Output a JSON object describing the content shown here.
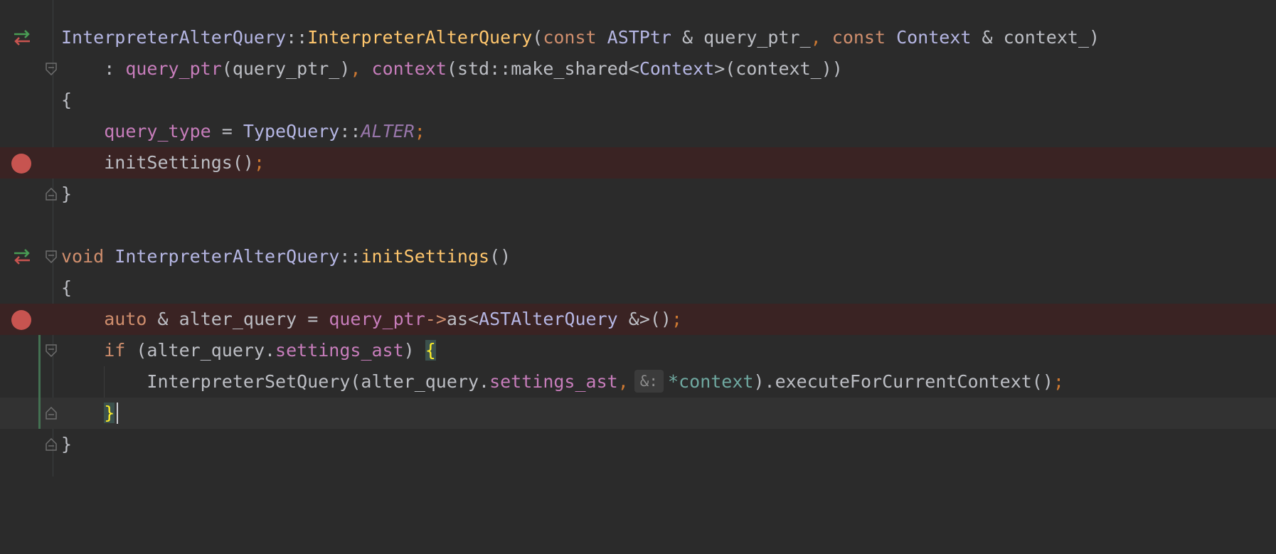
{
  "editor": {
    "lines": [
      {
        "id": "l1",
        "tokens": [
          {
            "t": "InterpreterAlterQuery",
            "c": "tok-type"
          },
          {
            "t": "::",
            "c": "tok-ns"
          },
          {
            "t": "InterpreterAlterQuery",
            "c": "tok-decl"
          },
          {
            "t": "(",
            "c": "tok-punc"
          },
          {
            "t": "const",
            "c": "tok-kw"
          },
          {
            "t": " ASTPtr ",
            "c": "tok-type"
          },
          {
            "t": "& query_ptr_",
            "c": "tok-cls"
          },
          {
            "t": ",",
            "c": "tok-comma"
          },
          {
            "t": " ",
            "c": "tok-cls"
          },
          {
            "t": "const",
            "c": "tok-kw"
          },
          {
            "t": " Context ",
            "c": "tok-type"
          },
          {
            "t": "& context_)",
            "c": "tok-cls"
          }
        ]
      },
      {
        "id": "l2",
        "tokens": [
          {
            "t": "    : ",
            "c": "tok-cls"
          },
          {
            "t": "query_ptr",
            "c": "tok-mem"
          },
          {
            "t": "(query_ptr_)",
            "c": "tok-cls"
          },
          {
            "t": ",",
            "c": "tok-comma"
          },
          {
            "t": " ",
            "c": "tok-cls"
          },
          {
            "t": "context",
            "c": "tok-mem"
          },
          {
            "t": "(std::make_shared<",
            "c": "tok-cls"
          },
          {
            "t": "Context",
            "c": "tok-type"
          },
          {
            "t": ">(context_))",
            "c": "tok-cls"
          }
        ]
      },
      {
        "id": "l3",
        "tokens": [
          {
            "t": "{",
            "c": "tok-punc"
          }
        ]
      },
      {
        "id": "l4",
        "tokens": [
          {
            "t": "    ",
            "c": "tok-cls"
          },
          {
            "t": "query_type",
            "c": "tok-mem"
          },
          {
            "t": " = ",
            "c": "tok-cls"
          },
          {
            "t": "TypeQuery",
            "c": "tok-type"
          },
          {
            "t": "::",
            "c": "tok-ns"
          },
          {
            "t": "ALTER",
            "c": "tok-const"
          },
          {
            "t": ";",
            "c": "tok-semi"
          }
        ]
      },
      {
        "id": "l5",
        "tokens": [
          {
            "t": "    initSettings()",
            "c": "tok-cls"
          },
          {
            "t": ";",
            "c": "tok-semi"
          }
        ]
      },
      {
        "id": "l6",
        "tokens": [
          {
            "t": "}",
            "c": "tok-punc"
          }
        ]
      },
      {
        "id": "l7",
        "tokens": []
      },
      {
        "id": "l8",
        "tokens": [
          {
            "t": "void",
            "c": "tok-kw"
          },
          {
            "t": " ",
            "c": "tok-cls"
          },
          {
            "t": "InterpreterAlterQuery",
            "c": "tok-type"
          },
          {
            "t": "::",
            "c": "tok-ns"
          },
          {
            "t": "initSettings",
            "c": "tok-decl"
          },
          {
            "t": "()",
            "c": "tok-punc"
          }
        ]
      },
      {
        "id": "l9",
        "tokens": [
          {
            "t": "{",
            "c": "tok-punc"
          }
        ]
      },
      {
        "id": "l10",
        "tokens": [
          {
            "t": "    ",
            "c": "tok-cls"
          },
          {
            "t": "auto",
            "c": "tok-kw"
          },
          {
            "t": " & alter_query = ",
            "c": "tok-cls"
          },
          {
            "t": "query_ptr",
            "c": "tok-mem"
          },
          {
            "t": "->",
            "c": "tok-kw"
          },
          {
            "t": "as<",
            "c": "tok-cls"
          },
          {
            "t": "ASTAlterQuery",
            "c": "tok-type"
          },
          {
            "t": " &>()",
            "c": "tok-cls"
          },
          {
            "t": ";",
            "c": "tok-semi"
          }
        ]
      },
      {
        "id": "l11",
        "tokens": [
          {
            "t": "    ",
            "c": "tok-cls"
          },
          {
            "t": "if",
            "c": "tok-kw"
          },
          {
            "t": " (alter_query.",
            "c": "tok-cls"
          },
          {
            "t": "settings_ast",
            "c": "tok-mem"
          },
          {
            "t": ") ",
            "c": "tok-cls"
          },
          {
            "t": "{",
            "c": "tok-brace-hl"
          }
        ]
      },
      {
        "id": "l12",
        "tokens": [
          {
            "t": "        InterpreterSetQuery(alter_query.",
            "c": "tok-cls"
          },
          {
            "t": "settings_ast",
            "c": "tok-mem"
          },
          {
            "t": ",",
            "c": "tok-comma"
          },
          {
            "t": "&:",
            "c": "tok-hint"
          },
          {
            "t": "*context",
            "c": "tok-ctx"
          },
          {
            "t": ").executeForCurrentContext()",
            "c": "tok-cls"
          },
          {
            "t": ";",
            "c": "tok-semi"
          }
        ]
      },
      {
        "id": "l13",
        "tokens": [
          {
            "t": "    ",
            "c": "tok-cls"
          },
          {
            "t": "}",
            "c": "tok-brace-hl"
          }
        ]
      },
      {
        "id": "l14",
        "tokens": [
          {
            "t": "}",
            "c": "tok-punc"
          }
        ]
      }
    ]
  }
}
